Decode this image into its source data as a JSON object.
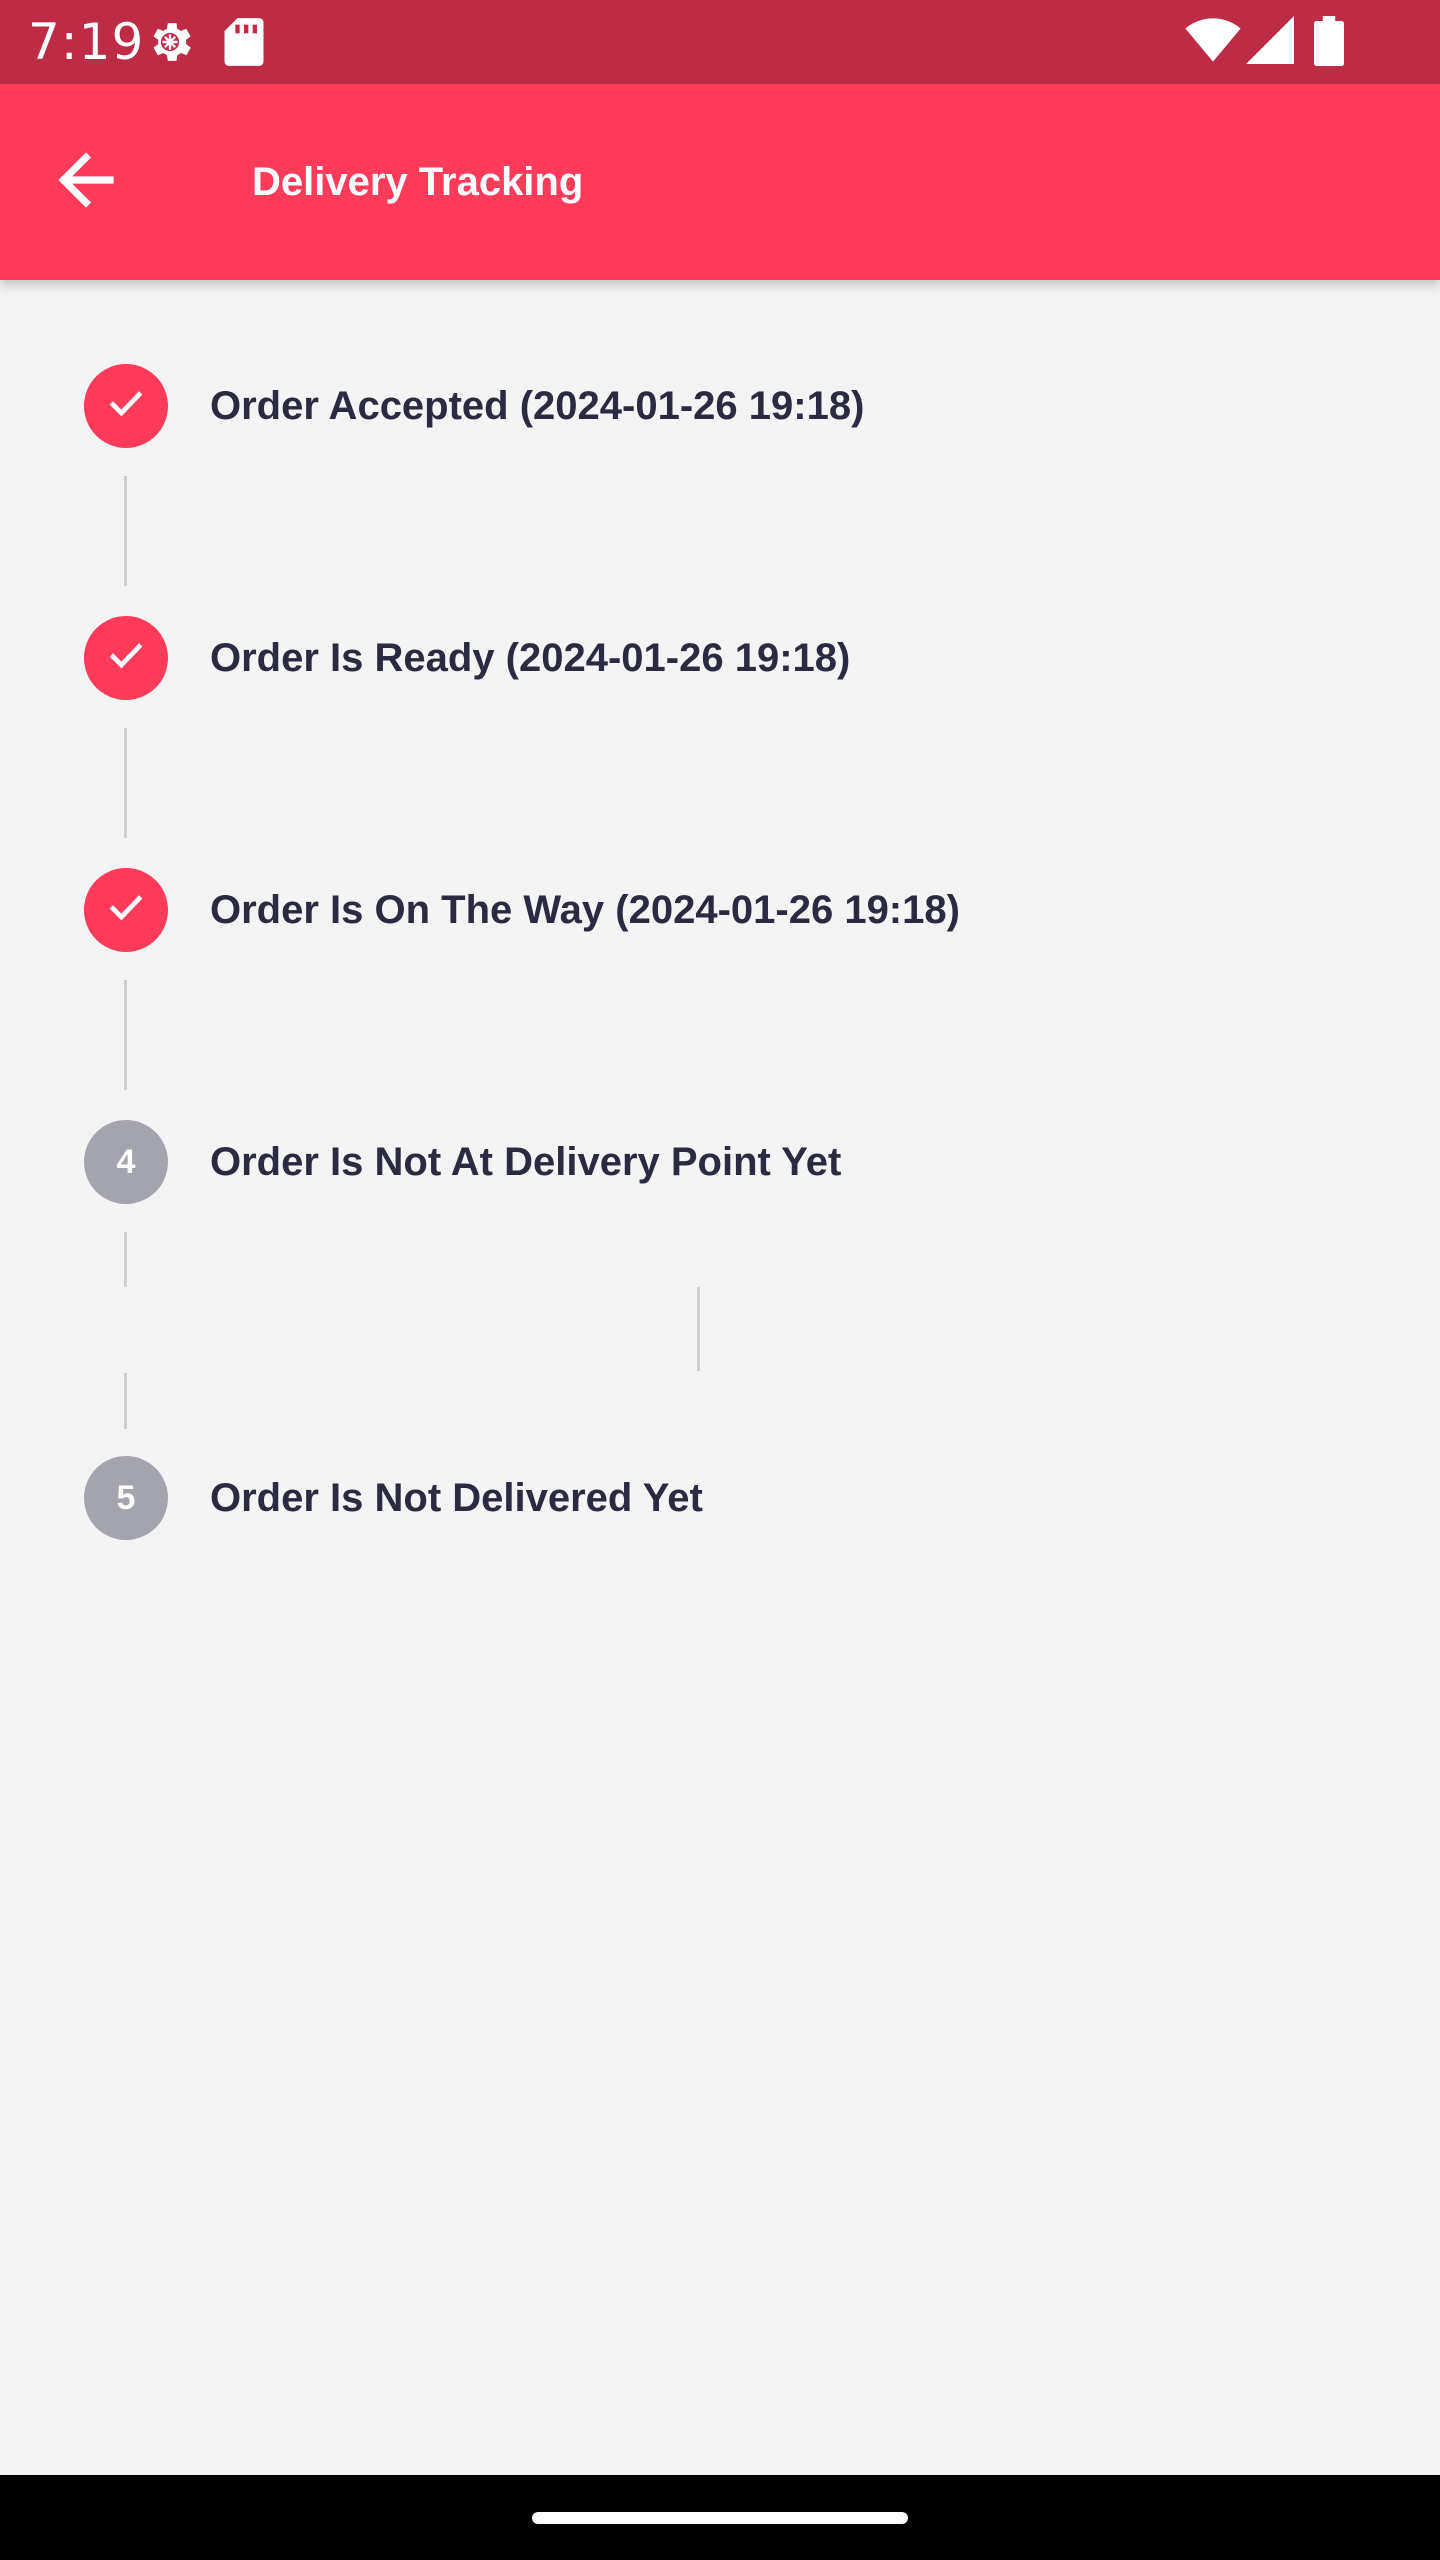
{
  "status_bar": {
    "time": "7:19",
    "left_icons": [
      "settings-gear-icon",
      "sd-card-icon"
    ],
    "right_icons": [
      "wifi-icon",
      "cellular-signal-icon",
      "battery-icon"
    ]
  },
  "app_bar": {
    "back_icon": "arrow-back-icon",
    "title": "Delivery Tracking",
    "color": "#ff3b5a"
  },
  "steps": [
    {
      "status": "done",
      "marker": "check-icon",
      "label": "Order Accepted (2024-01-26 19:18)"
    },
    {
      "status": "done",
      "marker": "check-icon",
      "label": "Order Is Ready (2024-01-26 19:18)"
    },
    {
      "status": "done",
      "marker": "check-icon",
      "label": "Order Is On The Way (2024-01-26 19:18)"
    },
    {
      "status": "pending",
      "marker": "4",
      "label": "Order Is Not At Delivery Point Yet"
    },
    {
      "status": "pending",
      "marker": "5",
      "label": "Order Is Not Delivered Yet"
    }
  ],
  "colors": {
    "status_bar": "#bd2b47",
    "accent": "#ff3b5a",
    "pending": "#a4a4ae",
    "text": "#2a2a40",
    "background": "#f4f4f4"
  }
}
